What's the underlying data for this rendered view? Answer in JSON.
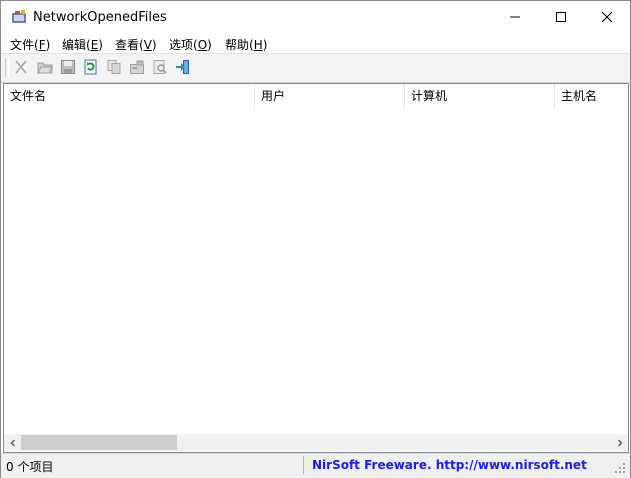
{
  "window": {
    "title": "NetworkOpenedFiles",
    "icon": "app-icon",
    "controls": [
      "minimize-icon",
      "maximize-icon",
      "close-icon"
    ]
  },
  "menu": [
    {
      "label": "文件(",
      "key": "F",
      "suffix": ")"
    },
    {
      "label": "编辑(",
      "key": "E",
      "suffix": ")"
    },
    {
      "label": "查看(",
      "key": "V",
      "suffix": ")"
    },
    {
      "label": "选项(",
      "key": "O",
      "suffix": ")"
    },
    {
      "label": "帮助(",
      "key": "H",
      "suffix": ")"
    }
  ],
  "toolbar": {
    "buttons": [
      {
        "icon": "cut-icon",
        "enabled": false
      },
      {
        "icon": "open-folder-icon",
        "enabled": false
      },
      {
        "icon": "save-icon",
        "enabled": false
      },
      {
        "icon": "refresh-icon",
        "enabled": true
      },
      {
        "icon": "copy-icon",
        "enabled": false
      },
      {
        "icon": "properties-icon",
        "enabled": false
      },
      {
        "icon": "find-icon",
        "enabled": false
      },
      {
        "icon": "exit-icon",
        "enabled": true
      }
    ]
  },
  "list": {
    "columns": [
      "文件名",
      "用户",
      "计算机",
      "主机名"
    ],
    "rows": []
  },
  "status": {
    "item_count": "0 个项目",
    "link_text": "NirSoft Freeware.  http://www.nirsoft.net"
  },
  "colors": {
    "link": "#1a1aff",
    "toolbar_bg": "#f3f3f3",
    "statusbar_bg": "#f0f0f0"
  }
}
